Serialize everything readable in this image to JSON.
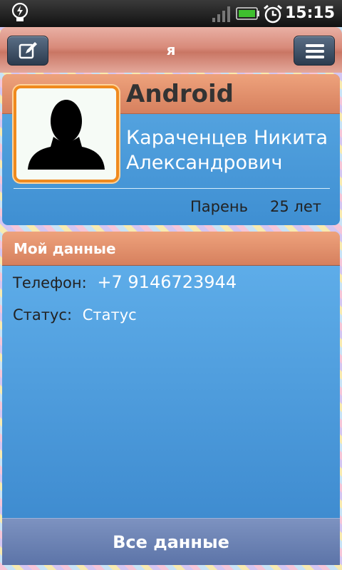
{
  "status_bar": {
    "time": "15:15",
    "icons": [
      "lightbulb-icon",
      "signal-icon",
      "battery-icon",
      "alarm-clock-icon"
    ]
  },
  "header": {
    "title": "я",
    "left_button_icon": "edit-icon",
    "right_button_icon": "menu-icon"
  },
  "profile": {
    "app_name": "Android",
    "full_name_line1": "Караченцев Никита",
    "full_name_line2": "Александрович",
    "gender": "Парень",
    "age": "25 лет",
    "avatar_icon": "person-silhouette-icon"
  },
  "data_section": {
    "header": "Мой данные",
    "phone_label": "Телефон:",
    "phone_value": "+7 9146723944",
    "status_label": "Статус:",
    "status_value": "Статус"
  },
  "footer": {
    "all_data_label": "Все данные"
  },
  "colors": {
    "header_orange": "#d6805e",
    "card_blue": "#4a9adb",
    "avatar_border": "#f08a1e",
    "button_dark": "#2c3b4e",
    "footer_button": "#6b82b4"
  }
}
